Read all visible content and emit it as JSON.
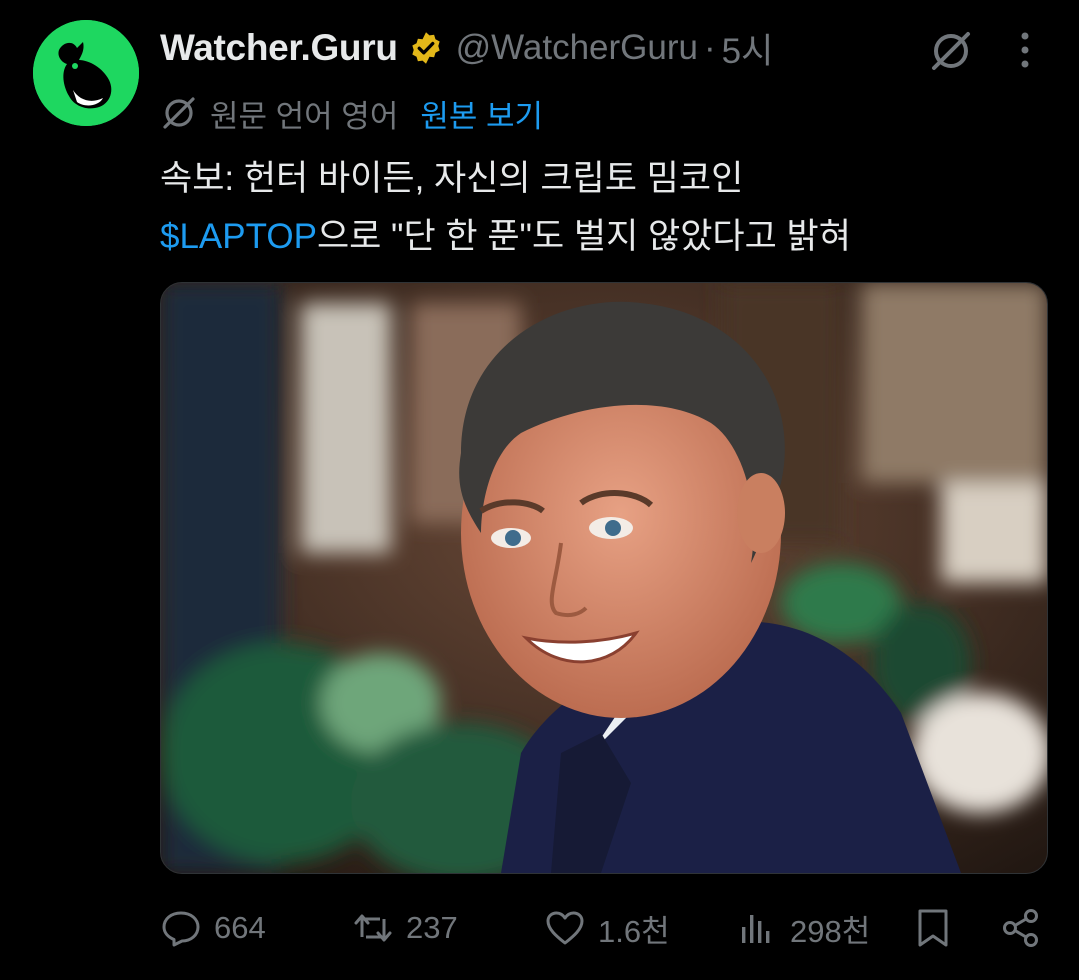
{
  "author": {
    "display_name": "Watcher.Guru",
    "handle": "@WatcherGuru",
    "separator": "·",
    "time": "5시"
  },
  "translation": {
    "label": "원문 언어 영어",
    "link": "원본 보기"
  },
  "tweet": {
    "line1": "속보: 헌터 바이든, 자신의 크립토 밈코인",
    "cashtag": "$LAPTOP",
    "line2_rest": "으로 \"단 한 푼\"도 벌지 않았다고 밝혀"
  },
  "media": {
    "description_icon": "photo"
  },
  "actions": {
    "reply_count": "664",
    "repost_count": "237",
    "like_count": "1.6천",
    "view_count": "298천"
  },
  "icons": {
    "avatar": "whale-logo-icon",
    "verified": "verified-badge-icon",
    "grok": "grok-icon",
    "more": "more-icon",
    "translate": "translate-icon",
    "reply": "reply-icon",
    "repost": "repost-icon",
    "like": "heart-icon",
    "views": "views-icon",
    "bookmark": "bookmark-icon",
    "share": "share-icon"
  },
  "colors": {
    "background": "#000000",
    "accent": "#1d9bf0",
    "muted": "#71767b",
    "avatar_green": "#1ed760",
    "verified_gold": "#e2b719"
  }
}
